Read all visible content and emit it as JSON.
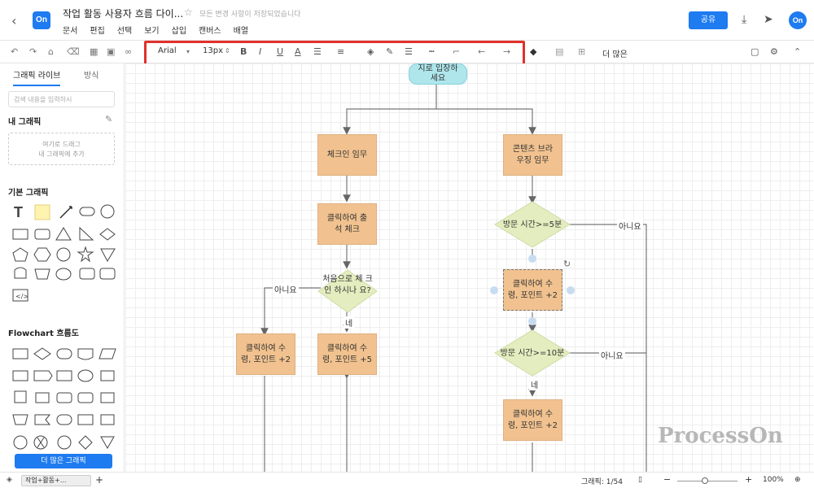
{
  "header": {
    "logo_text": "On",
    "title": "작업 활동 사용자 흐름 다이...",
    "saved_text": "모든 변경 사항이 저장되었습니다",
    "menus": [
      "문서",
      "편집",
      "선택",
      "보기",
      "삽입",
      "캔버스",
      "배열"
    ],
    "share_label": "공유",
    "avatar_text": "On"
  },
  "toolbar": {
    "font": "Arial",
    "size": "13px",
    "more_label": "더 많은"
  },
  "sidebar": {
    "tabs": [
      "그래픽 라이브",
      "방식"
    ],
    "search_placeholder": "검색 내용을 입력하시",
    "my_graphics": "내 그래픽",
    "drop_line1": "여기로 드래그",
    "drop_line2": "내 그래픽에 추가",
    "basic_graphics": "기본 그래픽",
    "flowchart": "Flowchart 흐름도",
    "more_graphics": "더 많은 그래픽"
  },
  "canvas": {
    "start": "지로 입장하\n세요",
    "nodes": {
      "checkin": "체크인 임무",
      "content": "콘텐츠 브라\n우징 임무",
      "click_checkin": "클릭하여 출\n석 체크",
      "first_checkin": "처음으로 체\n크인 하시나\n요?",
      "visit5": "방문 시간>=5분",
      "click_point2_sel": "클릭하여 수\n령, 포인트 +2",
      "click_point2_left": "클릭하여 수\n령, 포인트 +2",
      "click_point5": "클릭하여 수\n령, 포인트 +5",
      "visit10": "방문 시간>=10분",
      "click_point2_bottom": "클릭하여 수\n령, 포인트 +2"
    },
    "labels": {
      "no1": "아니요",
      "no2": "아니요",
      "no3": "아니요",
      "yes1": "네",
      "yes2": "네"
    },
    "watermark": "ProcessOn"
  },
  "status": {
    "page_tab": "작업+활동+...",
    "graphics_count": "그래픽: 1/54",
    "zoom": "100%"
  }
}
